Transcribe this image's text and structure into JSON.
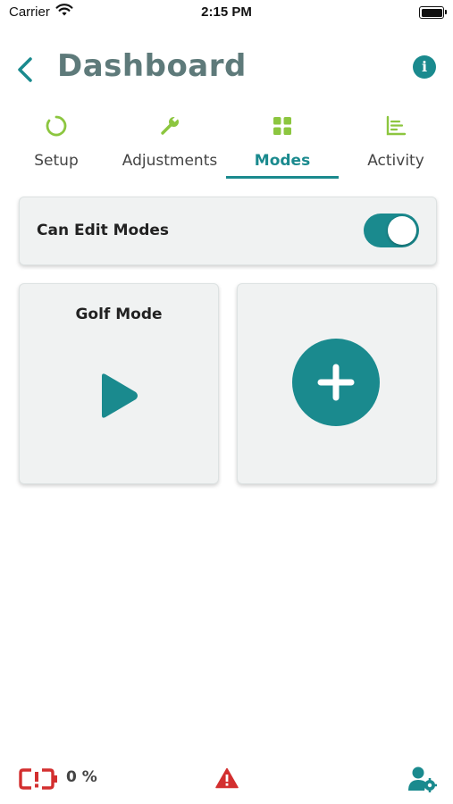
{
  "status_bar": {
    "carrier": "Carrier",
    "time": "2:15 PM"
  },
  "header": {
    "title": "Dashboard"
  },
  "tabs": [
    {
      "label": "Setup",
      "icon": "ring-icon"
    },
    {
      "label": "Adjustments",
      "icon": "wrench-icon"
    },
    {
      "label": "Modes",
      "icon": "grid-icon",
      "active": true
    },
    {
      "label": "Activity",
      "icon": "chart-icon"
    }
  ],
  "edit_modes": {
    "label": "Can Edit Modes",
    "enabled": true
  },
  "modes": [
    {
      "name": "Golf Mode"
    }
  ],
  "bottom_bar": {
    "battery_percent": "0 %"
  },
  "colors": {
    "accent": "#1a8a8e",
    "tab_icon_green": "#8cc63f",
    "alert_red": "#d32f2f"
  }
}
